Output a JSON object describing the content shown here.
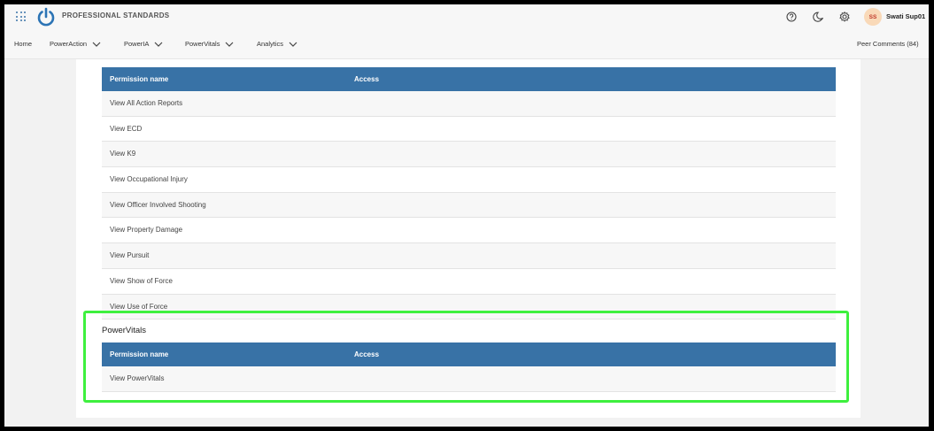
{
  "header": {
    "brand": "PROFESSIONAL STANDARDS",
    "user_initials": "SS",
    "user_name": "Swati Sup01"
  },
  "nav": {
    "home": "Home",
    "items": [
      "PowerAction",
      "PowerIA",
      "PowerVitals",
      "Analytics"
    ],
    "peer_comments": "Peer Comments (84)"
  },
  "table1": {
    "headers": [
      "Permission name",
      "Access"
    ],
    "rows": [
      "View All Action Reports",
      "View ECD",
      "View K9",
      "View Occupational Injury",
      "View Officer Involved Shooting",
      "View Property Damage",
      "View Pursuit",
      "View Show of Force",
      "View Use of Force"
    ]
  },
  "section2": {
    "title": "PowerVitals",
    "headers": [
      "Permission name",
      "Access"
    ],
    "rows": [
      "View PowerVitals"
    ]
  },
  "colors": {
    "header_blue": "#3872a6",
    "highlight_green": "#3ef03e"
  }
}
